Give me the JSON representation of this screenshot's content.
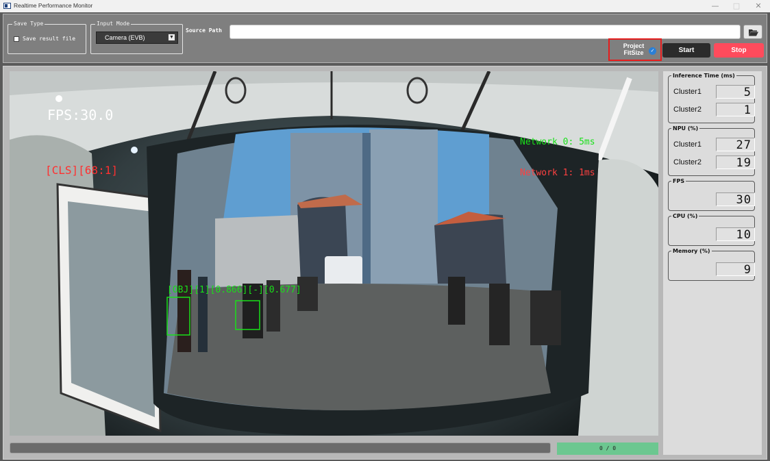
{
  "window": {
    "title": "Realtime Performance Monitor",
    "minimize": "—",
    "maximize": "□",
    "close": "✕"
  },
  "toolbar": {
    "save_type": {
      "title": "Save Type",
      "checkbox_label": "Save result file",
      "checked": false
    },
    "input_mode": {
      "title": "Input Mode",
      "selected": "Camera (EVB)"
    },
    "source_path": {
      "label": "Source Path",
      "value": "",
      "browse_icon": "folder-icon"
    },
    "project_fitsize": {
      "label_line1": "Project",
      "label_line2": "FitSize",
      "checked": true
    },
    "start_label": "Start",
    "stop_label": "Stop",
    "colors": {
      "stop": "#ff4b5c",
      "start": "#2b2b2b",
      "highlight": "#e61c1c"
    }
  },
  "video": {
    "fps_text": "FPS:30.0",
    "cls_text": "[CLS][68:1]",
    "network0_text": "Network 0: 5ms",
    "network1_text": "Network 1: 1ms",
    "detection_text": "[OBJ][1][0.866][-][0.677]"
  },
  "progress": {
    "fraction": 0,
    "counter": "0 / 0"
  },
  "metrics": {
    "inference": {
      "title": "Inference Time (ms)",
      "cluster1_label": "Cluster1",
      "cluster1_value": "5",
      "cluster2_label": "Cluster2",
      "cluster2_value": "1"
    },
    "npu": {
      "title": "NPU (%)",
      "cluster1_label": "Cluster1",
      "cluster1_value": "27",
      "cluster2_label": "Cluster2",
      "cluster2_value": "19"
    },
    "fps": {
      "title": "FPS",
      "value": "30"
    },
    "cpu": {
      "title": "CPU (%)",
      "value": "10"
    },
    "memory": {
      "title": "Memory (%)",
      "value": "9"
    }
  }
}
